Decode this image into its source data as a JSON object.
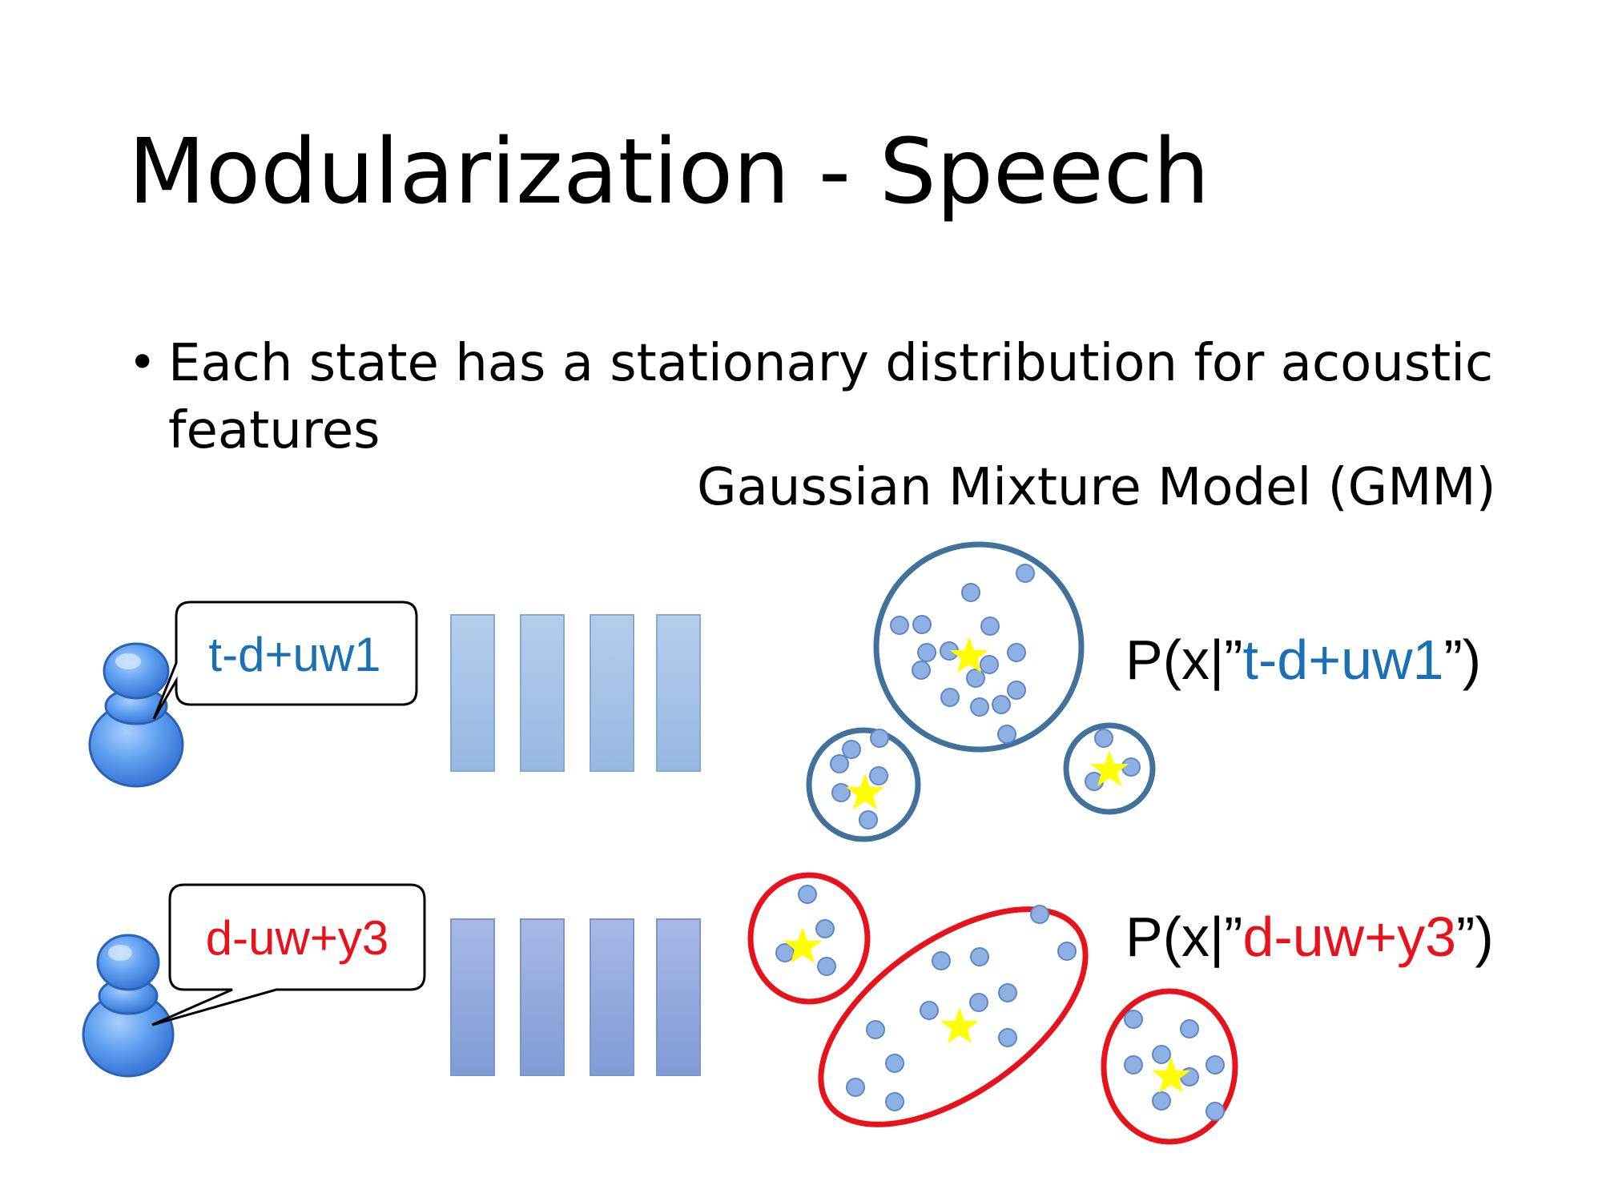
{
  "slide": {
    "title": "Modularization - Speech",
    "bullet": {
      "marker": "•",
      "text": "Each state has a stationary distribution for acoustic features"
    },
    "gmm_caption": "Gaussian Mixture Model (GMM)"
  },
  "rows": [
    {
      "state_label": "t-d+uw1",
      "label_color": "#1a6fb5",
      "prob_prefix": "P(x|”",
      "prob_state": "t-d+uw1",
      "prob_suffix": "”)",
      "circle_color": "#41719c",
      "frame_color": "#a8c4e6"
    },
    {
      "state_label": "d-uw+y3",
      "label_color": "#e8121a",
      "prob_prefix": "P(x|”",
      "prob_state": "d-uw+y3",
      "prob_suffix": "”)",
      "circle_color": "#e8121a",
      "frame_color": "#8ea6d8"
    }
  ],
  "colors": {
    "dot_fill": "#8fb0e3",
    "dot_stroke": "#5f86c9",
    "star": "#ffff00",
    "speaker_icon": "#4f8fe6"
  },
  "icons": [
    "speaker-icon",
    "star-icon"
  ]
}
